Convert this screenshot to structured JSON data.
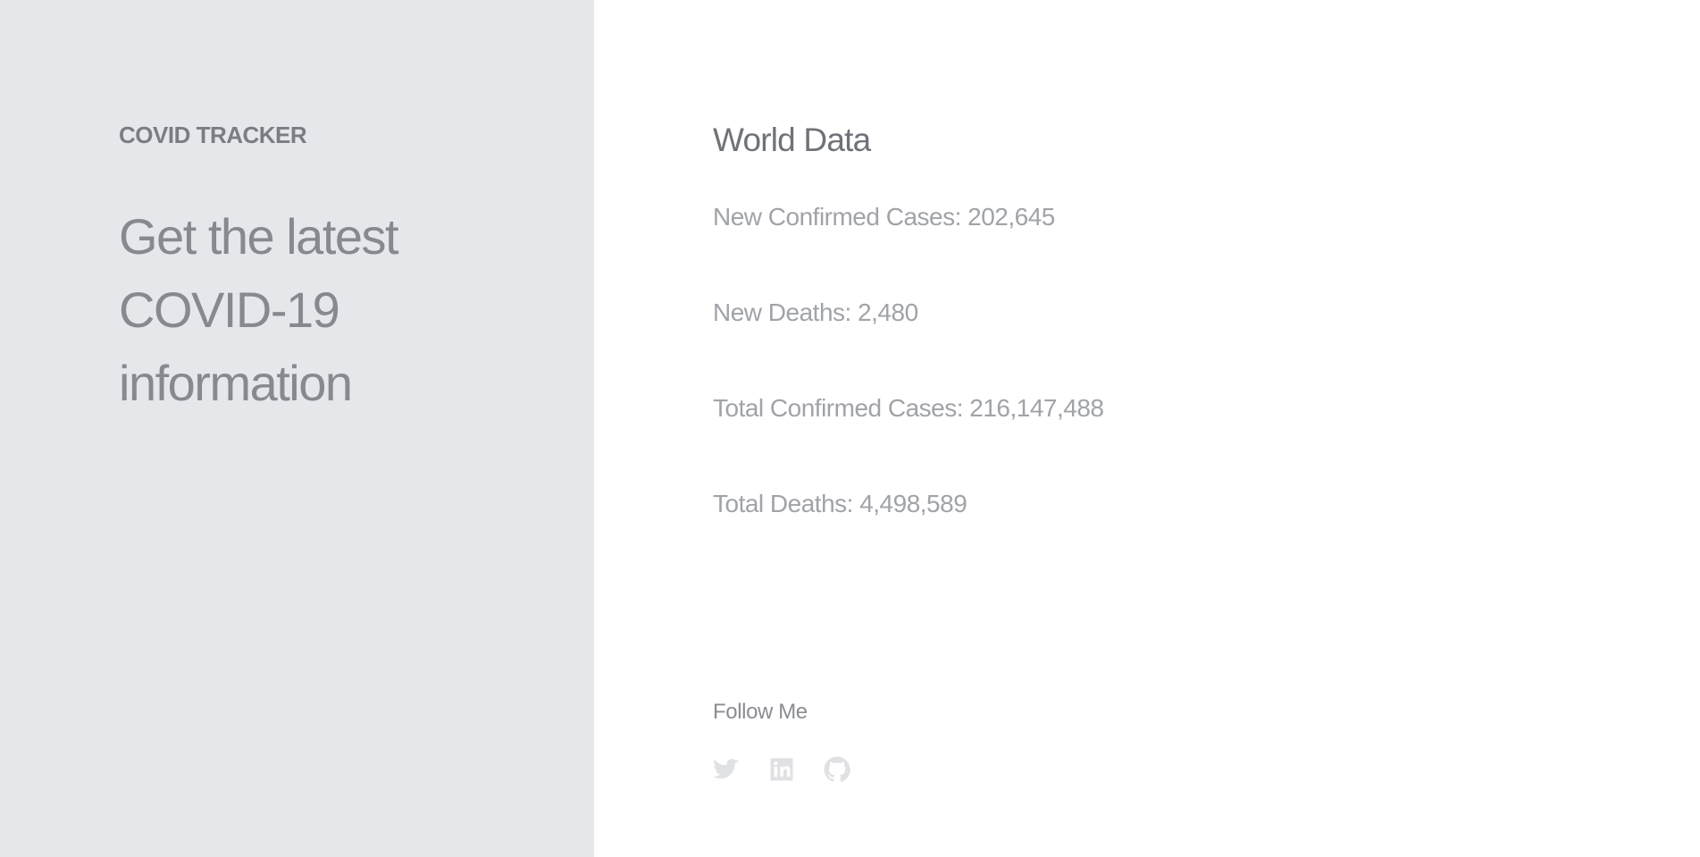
{
  "brand": {
    "name": "COVID TRACKER"
  },
  "hero": {
    "headline": "Get the latest COVID-19 information"
  },
  "world": {
    "title": "World Data",
    "stats": [
      {
        "text": "New Confirmed Cases: 202,645"
      },
      {
        "text": "New Deaths: 2,480"
      },
      {
        "text": "Total Confirmed Cases: 216,147,488"
      },
      {
        "text": "Total Deaths: 4,498,589"
      }
    ]
  },
  "follow": {
    "label": "Follow Me",
    "links": [
      {
        "icon": "twitter-icon"
      },
      {
        "icon": "linkedin-icon"
      },
      {
        "icon": "github-icon"
      }
    ]
  },
  "colors": {
    "sidebar_bg": "#e6e7eb",
    "main_bg": "#ffffff",
    "text_muted": "#a0a3a8",
    "icon": "#e0e1e4"
  }
}
